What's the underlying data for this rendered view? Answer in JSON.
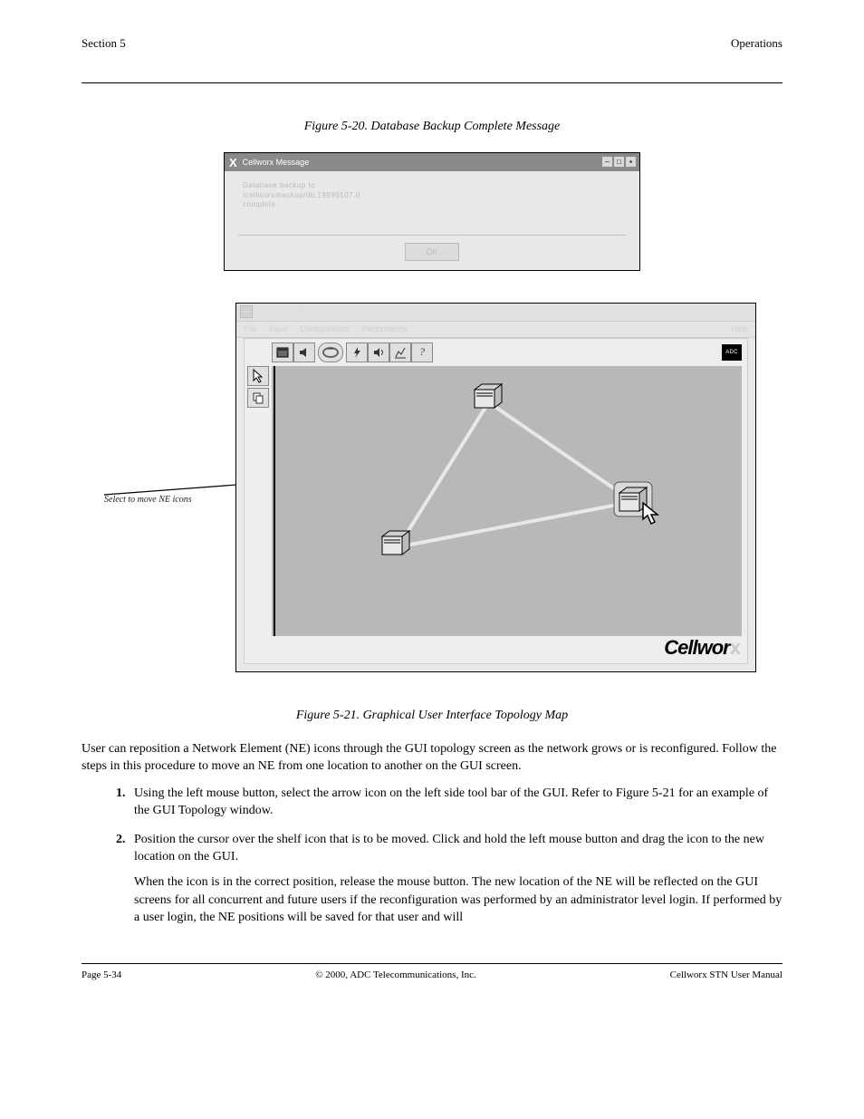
{
  "header": {
    "left": "Section 5",
    "right": "Operations"
  },
  "fig20": {
    "caption": "Figure 5-20. Database Backup Complete Message",
    "title": "Cellworx Message",
    "message_lines": [
      "Database backup to",
      "/cellworx/backup/db.19990107.0",
      "complete."
    ],
    "ok": "OK"
  },
  "fig21": {
    "caption": "Figure 5-21. Graphical User Interface Topology Map",
    "window_title": "Cellworx - (Ring Name)",
    "menus": [
      "File",
      "Fault",
      "Configuration",
      "Performance",
      "Help"
    ],
    "brand": "Cellwor",
    "brand_suffix": "x",
    "adc": "ADC"
  },
  "annotation": "Select to move NE icons",
  "para": "User can reposition a Network Element (NE) icons through the GUI topology screen as the network grows or is reconfigured. Follow the steps in this procedure to move an NE from one location to another on the GUI screen.",
  "steps": [
    {
      "text": "Using the left mouse button, select the arrow icon on the left side tool bar of the GUI. Refer to Figure 5-21 for an example of the GUI Topology window."
    },
    {
      "text": "Position the cursor over the shelf icon that is to be moved. Click and hold the left mouse button and drag the icon to the new location on the GUI.",
      "sub": "When the icon is in the correct position, release the mouse button. The new location of the NE will be reflected on the GUI screens for all concurrent and future users if the reconfiguration was performed by an administrator level login. If performed by a user login, the NE positions will be saved for that user and will"
    }
  ],
  "footer": {
    "left": "Page 5-34",
    "center": "© 2000, ADC Telecommunications, Inc.",
    "right": "Cellworx STN User Manual"
  }
}
